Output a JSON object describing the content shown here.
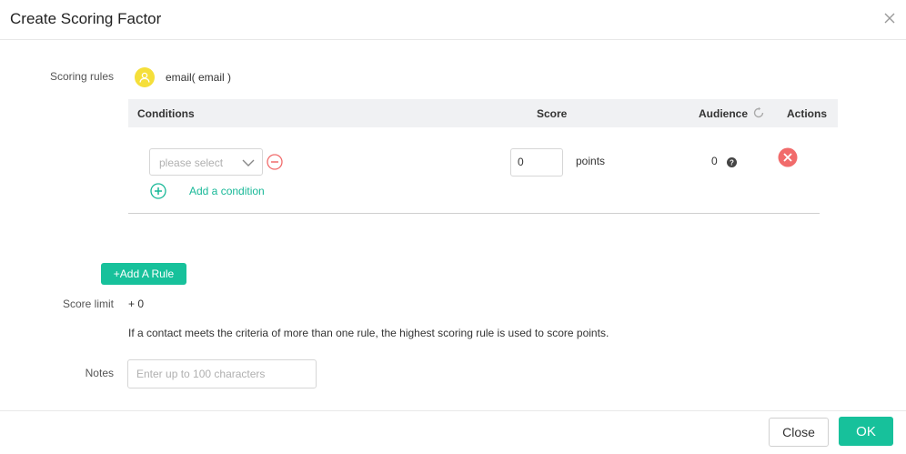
{
  "dialog": {
    "title": "Create Scoring Factor"
  },
  "scoring_rules": {
    "label": "Scoring rules",
    "field": "email( email )",
    "table": {
      "headers": {
        "conditions": "Conditions",
        "score": "Score",
        "audience": "Audience",
        "actions": "Actions"
      },
      "rows": [
        {
          "condition_placeholder": "please select",
          "add_condition_label": "Add a condition",
          "score": "0",
          "score_unit": "points",
          "audience": "0"
        }
      ]
    },
    "add_rule_label": "+Add A Rule"
  },
  "score_limit": {
    "label": "Score limit",
    "value": "+ 0",
    "hint": "If a contact meets the criteria of more than one rule, the highest scoring rule is used to score points."
  },
  "notes": {
    "label": "Notes",
    "placeholder": "Enter up to 100 characters"
  },
  "footer": {
    "close_label": "Close",
    "ok_label": "OK"
  },
  "colors": {
    "accent": "#17c19b",
    "link": "#17b897",
    "danger": "#f16b6b",
    "avatar": "#f5df3a"
  }
}
